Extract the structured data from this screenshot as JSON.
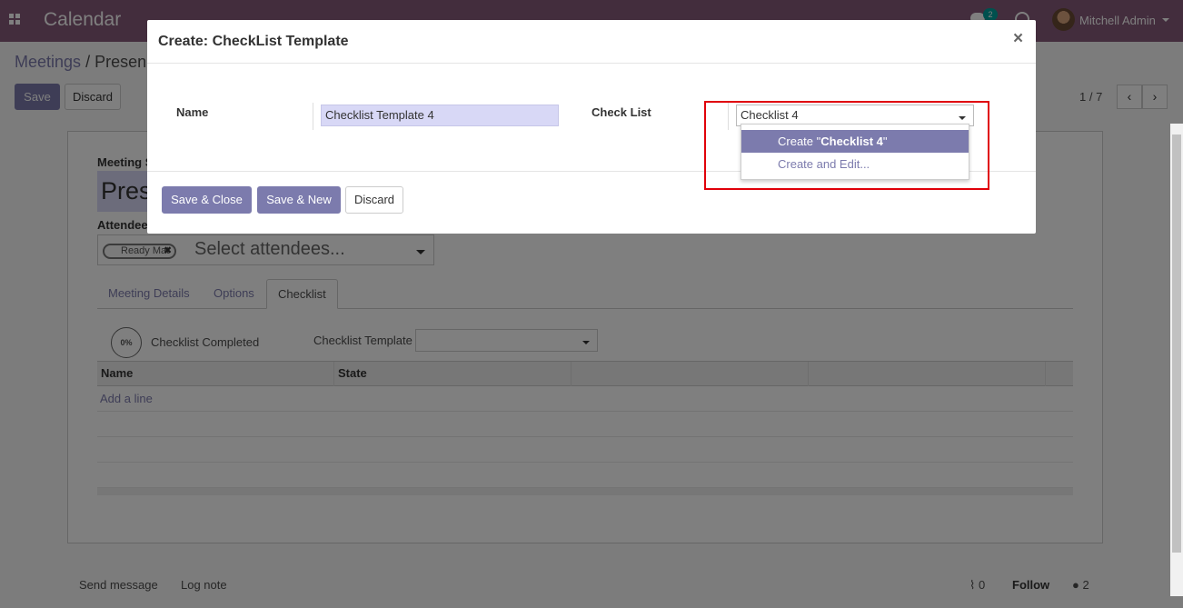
{
  "navbar": {
    "app_title": "Calendar",
    "chat_count": "2",
    "user_name": "Mitchell Admin"
  },
  "control_panel": {
    "breadcrumb_parent": "Meetings",
    "breadcrumb_separator": "/",
    "breadcrumb_current": "Presen",
    "save_label": "Save",
    "discard_label": "Discard",
    "pager": "1 / 7",
    "prev_icon": "‹",
    "next_icon": "›"
  },
  "form": {
    "meeting_subject_label": "Meeting S",
    "meeting_subject_value": "Pres",
    "attendees_label": "Attendee",
    "attendee_tag": "Ready Mat",
    "attendee_tag_remove": "✖",
    "attendees_placeholder": "Select attendees...",
    "tabs": [
      "Meeting Details",
      "Options",
      "Checklist"
    ],
    "active_tab": "Checklist",
    "progress": "0%",
    "checklist_completed_label": "Checklist Completed",
    "checklist_template_label": "Checklist Template",
    "table": {
      "headers": [
        "Name",
        "State",
        "",
        ""
      ],
      "add_line": "Add a line"
    }
  },
  "chatter": {
    "send_message": "Send message",
    "log_note": "Log note",
    "attachments_count": "0",
    "follow": "Follow",
    "followers_count": "2"
  },
  "modal": {
    "title": "Create: CheckList Template",
    "close_icon": "×",
    "name_label": "Name",
    "name_value": "Checklist Template 4",
    "checklist_label": "Check List",
    "checklist_value": "Checklist 4",
    "dropdown": {
      "create_prefix": "Create \"",
      "create_value": "Checklist 4",
      "create_suffix": "\"",
      "create_and_edit": "Create and Edit..."
    },
    "save_close": "Save & Close",
    "save_new": "Save & New",
    "discard": "Discard"
  },
  "colors": {
    "brand": "#875a7b",
    "primary": "#7c7bad",
    "highlight": "#e0000a"
  }
}
